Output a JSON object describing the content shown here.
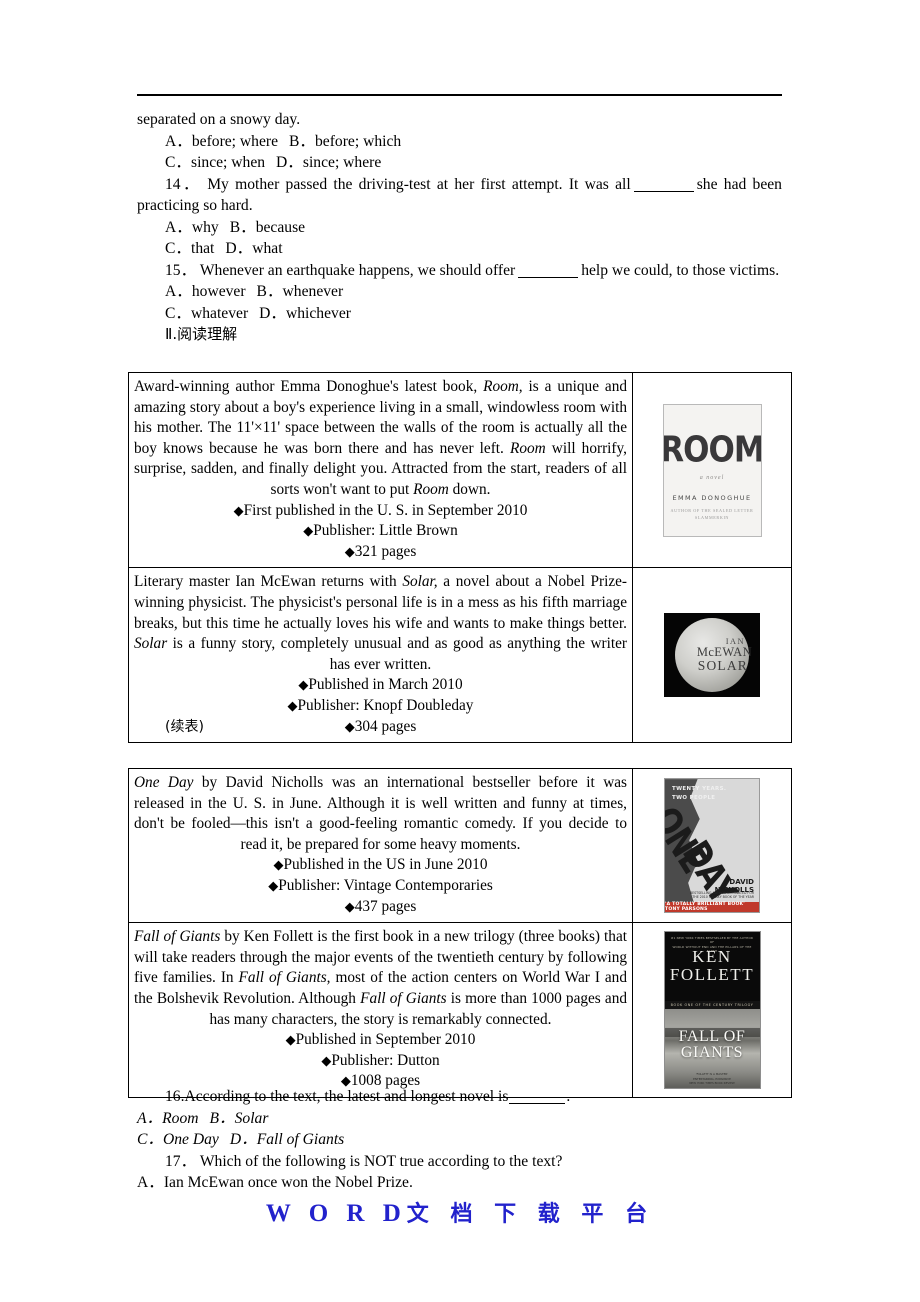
{
  "document": {
    "section_heading": "Ⅱ.阅读理解",
    "continuation_label": "(续表)",
    "watermark_latin": "W O R D",
    "watermark_cn": "文 档 下 载 平 台"
  },
  "grammar_items": [
    {
      "stem_tail": "separated on a snowy day.",
      "options_line1": "A．before; where",
      "options_line2": "B．before; which",
      "options_line3": "C．since; when",
      "options_line4": "D．since; where"
    },
    {
      "number": "14．",
      "stem_before": "My mother passed the driving-test at her first attempt. It was all",
      "stem_after": "she had been practicing so hard.",
      "options_line1": "A．why",
      "options_line2": "B．because",
      "options_line3": "C．that",
      "options_line4": "D．what"
    },
    {
      "number": "15．",
      "stem_before": "Whenever an earthquake happens, we should offer",
      "stem_after": "help we could, to those victims.",
      "options_line1": "A．however",
      "options_line2": "B．whenever",
      "options_line3": "C．whatever",
      "options_line4": "D．whichever"
    }
  ],
  "books": [
    {
      "id": "room",
      "paragraph_html": "Award-winning author Emma Donoghue's latest book, <i>Room,</i> is a unique and amazing story about a boy's experience living in a small, windowless room with his mother. The 11'×11' space between the walls of the room is actually all the boy knows because he was born there and has never left. <i>Room</i> will horrify, surprise, sadden, and finally delight you. Attracted from the start, readers of all sorts won't want to put <i>Room</i> down.",
      "bullet1": "First published in the U. S. in September 2010",
      "bullet2": "Publisher: Little Brown",
      "bullet3": "321 pages",
      "cover": {
        "title": "ROOM",
        "subtitle": "a novel",
        "author": "EMMA DONOGHUE",
        "blurb": "AUTHOR OF THE SEALED LETTER\nSLAMMERKIN"
      }
    },
    {
      "id": "solar",
      "paragraph_html": "Literary master Ian McEwan returns with <i>Solar,</i> a novel about a Nobel Prize-winning physicist. The physicist's personal life is in a mess as his fifth marriage breaks, but this time he actually loves his wife and wants to make things better. <i>Solar</i> is a funny story, completely unusual and as good as anything the writer has ever written.",
      "bullet1": "Published in March 2010",
      "bullet2": "Publisher: Knopf Doubleday",
      "bullet3": "304 pages",
      "cover": {
        "line1": "IAN",
        "line2": "McEWAN",
        "line3": "SOLAR"
      }
    },
    {
      "id": "oneday",
      "paragraph_html": "<i>One Day</i> by David Nicholls was an international bestseller before it was released in the U. S. in June. Although it is well written and funny at times, don't be fooled—this isn't a good-feeling romantic comedy. If you decide to read it, be prepared for some heavy moments.",
      "bullet1": "Published in the US in June 2010",
      "bullet2": "Publisher: Vintage Contemporaries",
      "bullet3": "437 pages",
      "cover": {
        "kicker": "TWENTY YEARS.\nTWO PEOPLE",
        "title_line1": "ONE",
        "title_line2": "DAY",
        "author": "DAVID\nNICHOLLS",
        "smallprint": "BESTSELLING AUTHOR NOMINATED FOR\nTHE 2010 GALAXY BOOK OF THE YEAR",
        "band": "'A TOTALLY BRILLIANT BOOK' TONY PARSONS"
      }
    },
    {
      "id": "fallofgiants",
      "paragraph_html": "<i>Fall of Giants</i> by Ken Follett is the first book in a new trilogy (three books) that will take readers through the major events of the twentieth century by following five families. In <i>Fall of Giants,</i> most of the action centers on World War I and the Bolshevik Revolution. Although <i>Fall of Giants</i> is more than 1000 pages and has many characters, the story is remarkably connected.",
      "bullet1": "Published in September 2010",
      "bullet2": "Publisher: Dutton",
      "bullet3": "1008 pages",
      "cover": {
        "blurb": "#1 NEW YORK TIMES BESTSELLER BY THE AUTHOR OF\nWORLD WITHOUT END AND THE PILLARS OF THE EARTH",
        "author": "KEN\nFOLLETT",
        "strip": "BOOK ONE OF THE CENTURY TRILOGY",
        "title": "FALL OF\nGIANTS",
        "foot": "'FOLLETT IS A MASTER'\nENTERTAINING, EXPANSIVE\nNEW YORK TIMES BOOK REVIEW"
      }
    }
  ],
  "reading_questions": [
    {
      "number_stem": "16.According to the text, the latest and longest novel is",
      "period": ".",
      "options_line1": "A．Room",
      "options_line2": "B．Solar",
      "options_line3": "C．One Day",
      "options_line4": "D．Fall of Giants"
    },
    {
      "number": "17．",
      "stem": "Which of the following is NOT true according to the text?",
      "options_line1": "A．Ian McEwan once won the Nobel Prize."
    }
  ]
}
